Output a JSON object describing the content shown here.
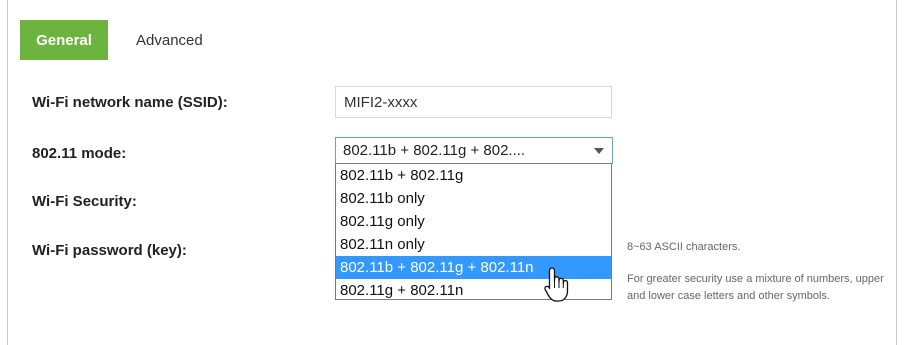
{
  "tabs": {
    "general": "General",
    "advanced": "Advanced"
  },
  "form": {
    "ssid_label": "Wi-Fi network name (SSID):",
    "ssid_value": "MIFI2-xxxx",
    "mode_label": "802.11 mode:",
    "mode_selected_display": "802.11b + 802.11g + 802....",
    "security_label": "Wi-Fi Security:",
    "password_label": "Wi-Fi password (key):"
  },
  "mode_options": [
    "802.11b + 802.11g",
    "802.11b only",
    "802.11g only",
    "802.11n only",
    "802.11b + 802.11g + 802.11n",
    "802.11g + 802.11n"
  ],
  "highlighted_option_index": 4,
  "help": {
    "length": "8~63 ASCII characters.",
    "security_tip": "For greater security use a mixture of numbers, upper and lower case letters and other symbols."
  },
  "colors": {
    "tab_active": "#6cb33f",
    "option_highlight": "#3399ff"
  },
  "icons": {
    "select_caret": "chevron-down-icon",
    "pointer": "hand-pointer-icon"
  }
}
